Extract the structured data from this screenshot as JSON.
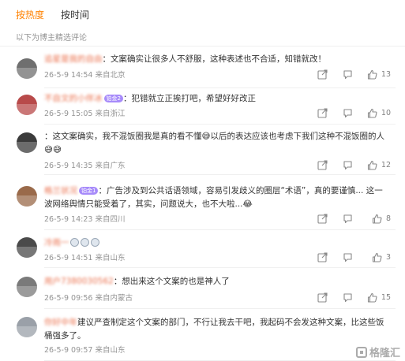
{
  "tabs": [
    {
      "label": "按热度",
      "active": true
    },
    {
      "label": "按时间",
      "active": false
    }
  ],
  "subhead": "以下为博主精选评论",
  "accent_color": "#ff8200",
  "username_color": "#eb7350",
  "comments": [
    {
      "username": "追星是我的自由",
      "badge": "",
      "text": "：文案确实让很多人不舒服，这种表述也不合适，知错就改！",
      "time": "26-5-9 14:54",
      "location": "来自北京",
      "likes": "13",
      "avatar_color": "#6f6f6f"
    },
    {
      "username": "不自文的小伴冰",
      "badge": "铂金2",
      "text": "：犯错就立正挨打吧，希望好好改正",
      "time": "26-5-9 15:05",
      "location": "来自浙江",
      "likes": "10",
      "avatar_color": "#b84a4a"
    },
    {
      "username": "",
      "badge": "",
      "text": "：这文案确实，我不混饭圈我是真的看不懂😅以后的表达应该也考虑下我们这种不混饭圈的人😅😅",
      "time": "26-5-9 14:35",
      "location": "来自广东",
      "likes": "12",
      "avatar_color": "#3b3b3b"
    },
    {
      "username": "格兰状况",
      "badge": "铂金1",
      "text": "：广告涉及到公共话语领域，容易引发歧义的圈层“术语”，真的要谨慎... 这一波网络舆情只能受着了，其实，问题说大，也不大啦...😂",
      "time": "26-5-9 14:23",
      "location": "来自四川",
      "likes": "8",
      "avatar_color": "#9a6a4a"
    },
    {
      "username": "冷雨一",
      "badge": "",
      "text": "",
      "time": "26-5-9 14:51",
      "location": "来自山东",
      "likes": "3",
      "avatar_color": "#4a4a4a"
    },
    {
      "username": "用户7380030562",
      "badge": "",
      "text": "：想出来这个文案的也是神人了",
      "time": "26-5-9 09:56",
      "location": "来自内蒙古",
      "likes": "15",
      "avatar_color": "#7a7a7a"
    },
    {
      "username": "你好中年",
      "badge": "",
      "text": "建议严查制定这个文案的部门，不行让我去干吧，我起码不会发这种文案，比这些饭桶强多了。",
      "time": "26-5-9 09:57",
      "location": "来自山东",
      "likes": "",
      "avatar_color": "#9aa0a8"
    }
  ],
  "watermark": "格隆汇",
  "icons": {
    "share": "share-icon",
    "comment": "comment-icon",
    "like": "like-icon"
  }
}
